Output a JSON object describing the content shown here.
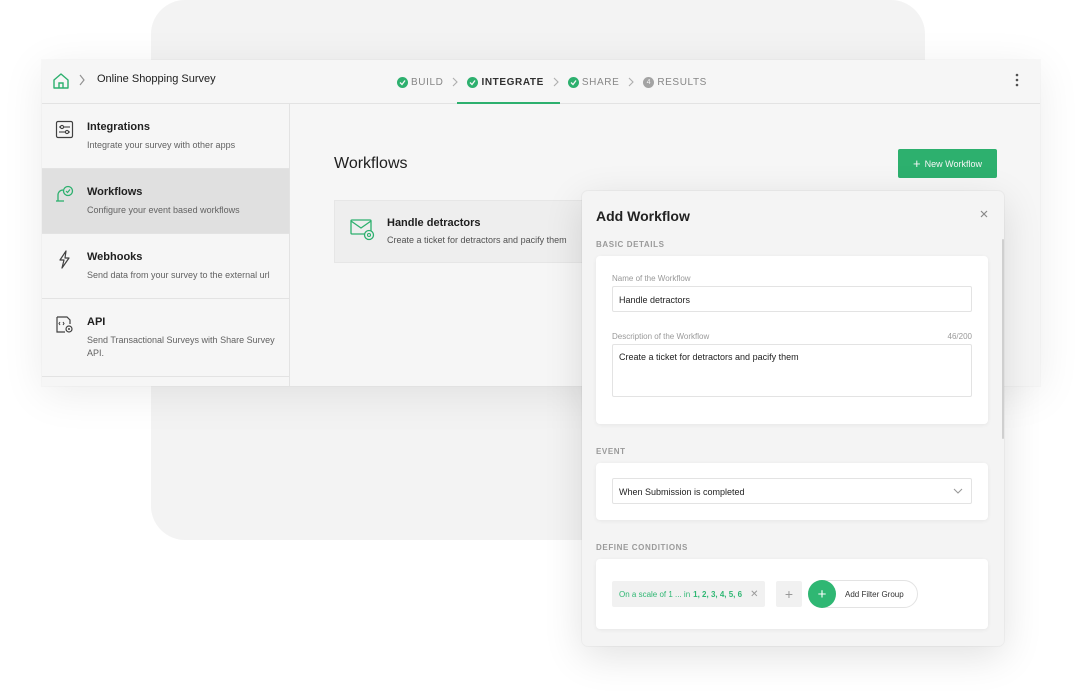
{
  "header": {
    "survey_title": "Online Shopping Survey",
    "steps": [
      {
        "label": "BUILD",
        "state": "done"
      },
      {
        "label": "INTEGRATE",
        "state": "active"
      },
      {
        "label": "SHARE",
        "state": "done"
      },
      {
        "label": "RESULTS",
        "state": "pending",
        "number": "4"
      }
    ]
  },
  "sidebar": {
    "items": [
      {
        "title": "Integrations",
        "desc": "Integrate your survey with other apps",
        "icon": "integrations-icon"
      },
      {
        "title": "Workflows",
        "desc": "Configure your event based workflows",
        "icon": "workflows-icon",
        "active": true
      },
      {
        "title": "Webhooks",
        "desc": "Send data from your survey to the external url",
        "icon": "webhooks-icon"
      },
      {
        "title": "API",
        "desc": "Send Transactional Surveys with Share Survey API.",
        "icon": "api-icon"
      }
    ]
  },
  "main": {
    "title": "Workflows",
    "new_button_label": "New Workflow",
    "workflow_card": {
      "title": "Handle detractors",
      "desc": "Create a ticket for detractors and pacify them"
    }
  },
  "panel": {
    "title": "Add Workflow",
    "basic_details_label": "BASIC DETAILS",
    "name_label": "Name of the Workflow",
    "name_value": "Handle detractors",
    "desc_label": "Description of the Workflow",
    "desc_counter": "46/200",
    "desc_value": "Create a ticket for detractors and pacify them",
    "event_label": "EVENT",
    "event_value": "When Submission is completed",
    "conditions_label": "DEFINE CONDITIONS",
    "condition_chip_prefix": "On a scale of 1 ... in",
    "condition_chip_values": "1, 2, 3, 4, 5, 6",
    "add_filter_group_label": "Add Filter Group"
  },
  "colors": {
    "accent": "#2fb773",
    "active_sidebar_bg": "#e9e9e9"
  }
}
